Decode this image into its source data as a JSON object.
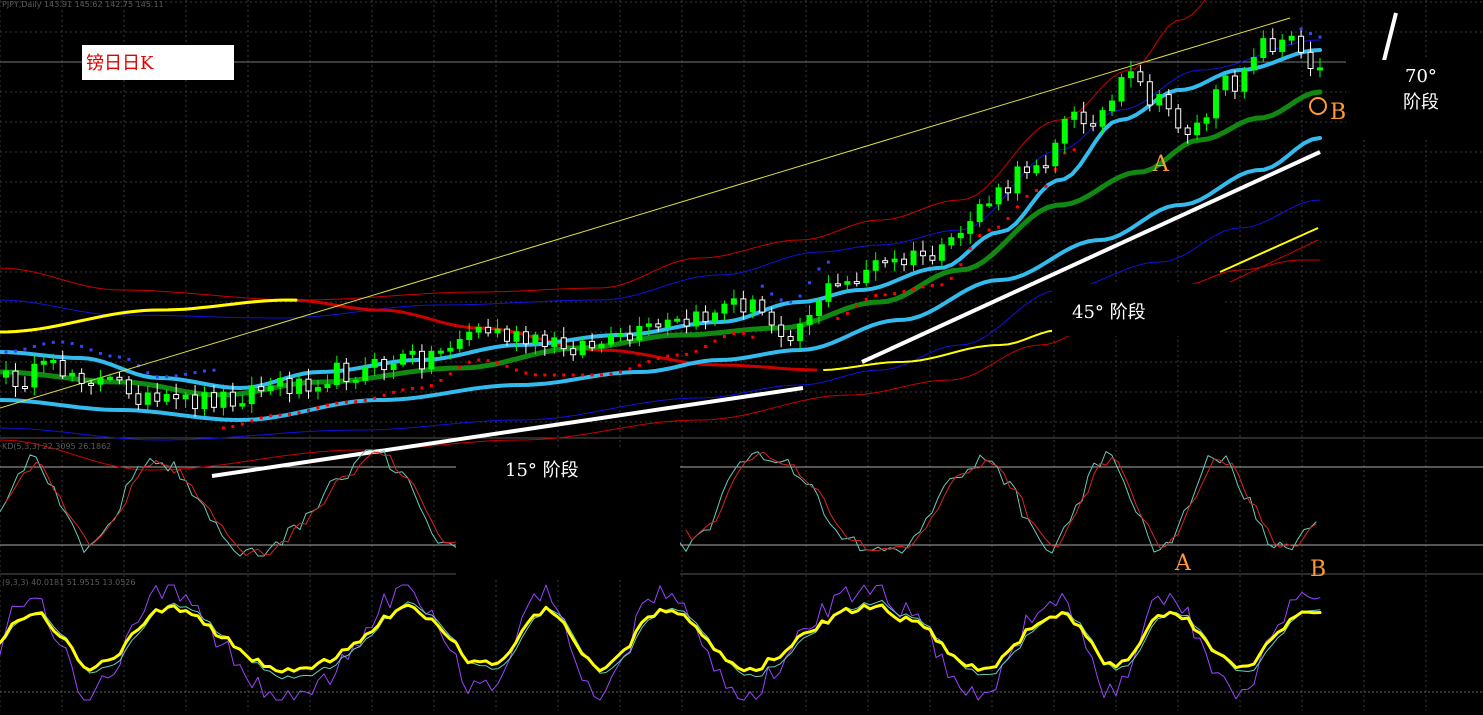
{
  "header": {
    "price_info": "PJPY,Daily  143.91 145.62 142.75 145.11",
    "indicator1_info": "KD(5,3,3) 22.3095 26.1862",
    "indicator2_info": "(9,3,3) 40.0181 51.9515 13.0526"
  },
  "title": "镑日日K",
  "stage_labels": [
    {
      "id": "stage-15",
      "text": "15°  阶段"
    },
    {
      "id": "stage-45",
      "text": "45°  阶段"
    },
    {
      "id": "stage-70-line1",
      "text": "70°"
    },
    {
      "id": "stage-70-line2",
      "text": "阶段"
    }
  ],
  "markers": {
    "main_a": "A",
    "main_b": "B",
    "ind_a": "A",
    "ind_b": "B"
  },
  "colors": {
    "background": "#000000",
    "grid": "#3a3a3a",
    "bull_candle": "#00ff00",
    "bear_candle": "#ffffff",
    "cyan_ma": "#33bbee",
    "green_ma": "#118811",
    "red_band": "#cc0000",
    "blue_band": "#1111dd",
    "yellow_ma": "#ffff00",
    "stage_line": "#ffffff",
    "sar_red": "#ff0000",
    "sar_blue": "#3344ff",
    "marker": "#ff9933",
    "kd_k": "#66ccbb",
    "kd_d": "#dd2222",
    "kdj_k": "#ffff00",
    "kdj_d": "#66ccbb",
    "kdj_j": "#9944ff"
  },
  "chart_data": {
    "type": "candlestick",
    "title": "镑日日K",
    "x": [
      1,
      140
    ],
    "ylim": [
      125,
      150
    ],
    "series": [
      {
        "type": "candlestick",
        "count": 140,
        "start": 131.5,
        "end": 145.11
      },
      {
        "type": "line"
      },
      {
        "type": "line"
      },
      {
        "type": "line"
      },
      {
        "type": "line"
      },
      {
        "type": "line"
      }
    ],
    "annotations": [
      "15°  阶段",
      "45°  阶段",
      "70°",
      "阶段",
      "A",
      "B"
    ],
    "indicator_panels": [
      {
        "type": "line",
        "levels": [
          20,
          80
        ],
        "series": [
          {
            "name": "K",
            "last": 22.3095
          },
          {
            "name": "D",
            "last": 26.1862
          }
        ]
      },
      {
        "type": "line",
        "series": [
          {
            "name": "K",
            "last": 40.0181
          },
          {
            "name": "D",
            "last": 51.9515
          },
          {
            "name": "J",
            "last": 13.0526
          }
        ]
      }
    ]
  }
}
